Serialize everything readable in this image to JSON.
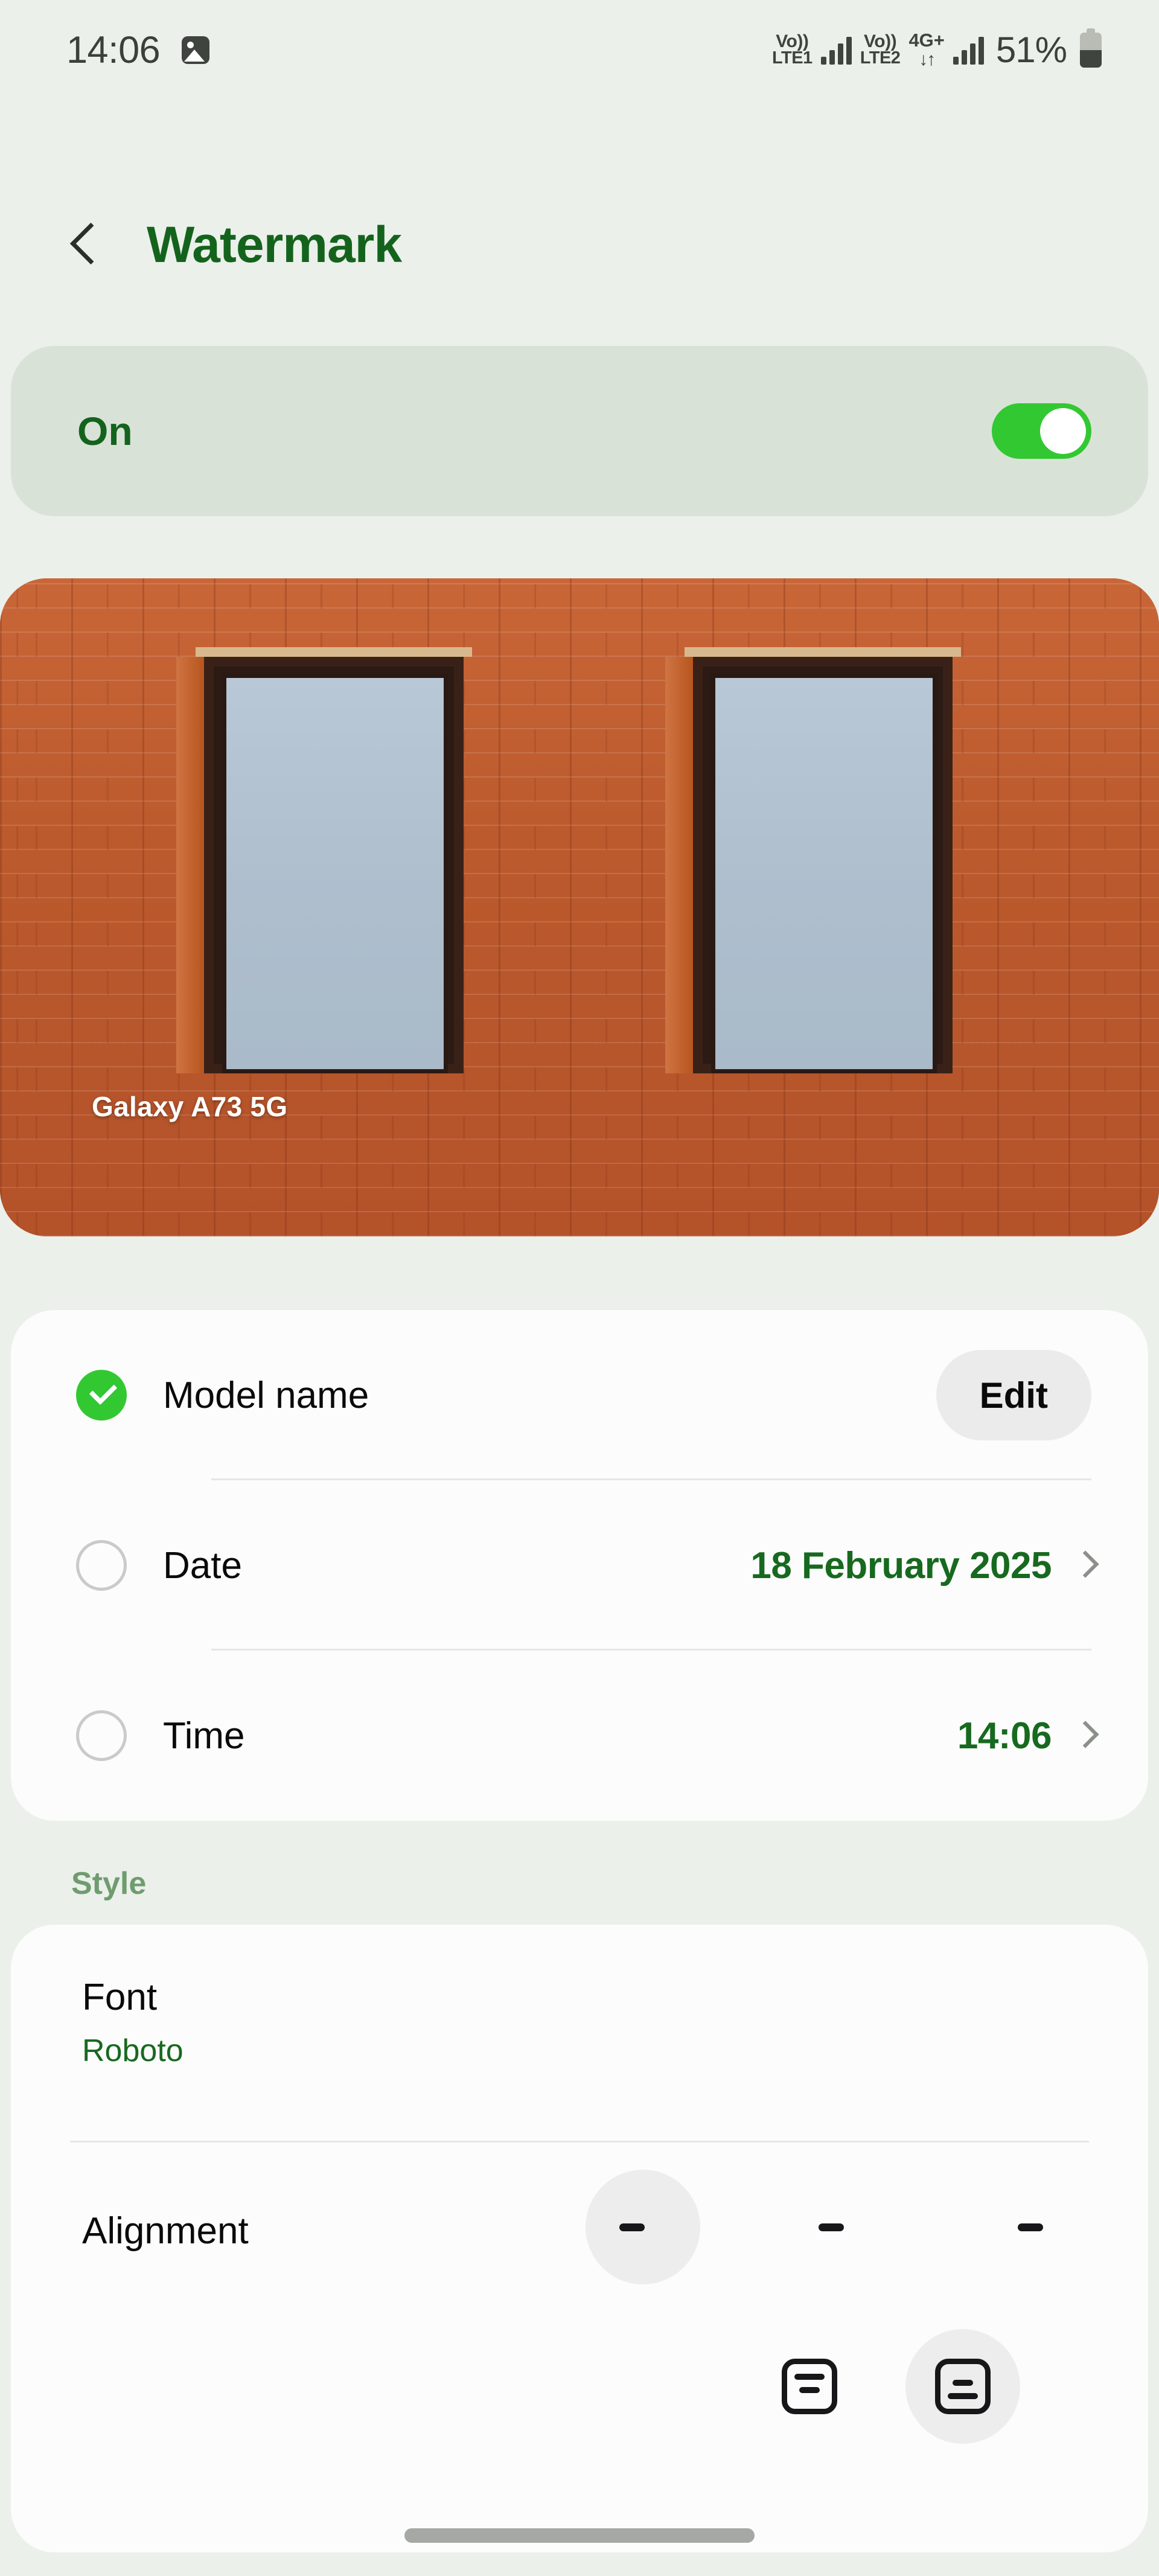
{
  "status_bar": {
    "clock": "14:06",
    "gallery_icon": "gallery-icon",
    "sim1_volte_line1": "Vo))",
    "sim1_volte_line2": "LTE1",
    "sim2_volte_line1": "Vo))",
    "sim2_volte_line2": "LTE2",
    "network_type": "4G+",
    "data_arrows": "↓↑",
    "battery_percent": "51%"
  },
  "header": {
    "back_icon": "back-chevron-icon",
    "title": "Watermark"
  },
  "master_toggle": {
    "label": "On",
    "state": "on"
  },
  "preview": {
    "watermark_text": "Galaxy A73 5G",
    "image_description": "brick-wall-with-two-windows"
  },
  "elements": {
    "rows": [
      {
        "label": "Model name",
        "checked": true,
        "action_label": "Edit",
        "value": ""
      },
      {
        "label": "Date",
        "checked": false,
        "value": "18 February 2025"
      },
      {
        "label": "Time",
        "checked": false,
        "value": "14:06"
      }
    ]
  },
  "style": {
    "section_title": "Style",
    "font": {
      "label": "Font",
      "value": "Roboto"
    },
    "alignment": {
      "label": "Alignment",
      "options": [
        {
          "name": "align-left",
          "selected": true
        },
        {
          "name": "align-center",
          "selected": false
        },
        {
          "name": "align-right",
          "selected": false
        }
      ],
      "position_options": [
        {
          "name": "position-top",
          "selected": false
        },
        {
          "name": "position-bottom",
          "selected": true
        }
      ]
    }
  },
  "colors": {
    "background": "#ebf0ea",
    "accent_green": "#17691f",
    "toggle_green": "#32c832",
    "card_white": "#fbfcfb",
    "toggle_card": "#d9e2d7",
    "section_label_green": "#6f9c6f"
  },
  "nav": {
    "gesture_bar": "home-gesture-bar"
  }
}
